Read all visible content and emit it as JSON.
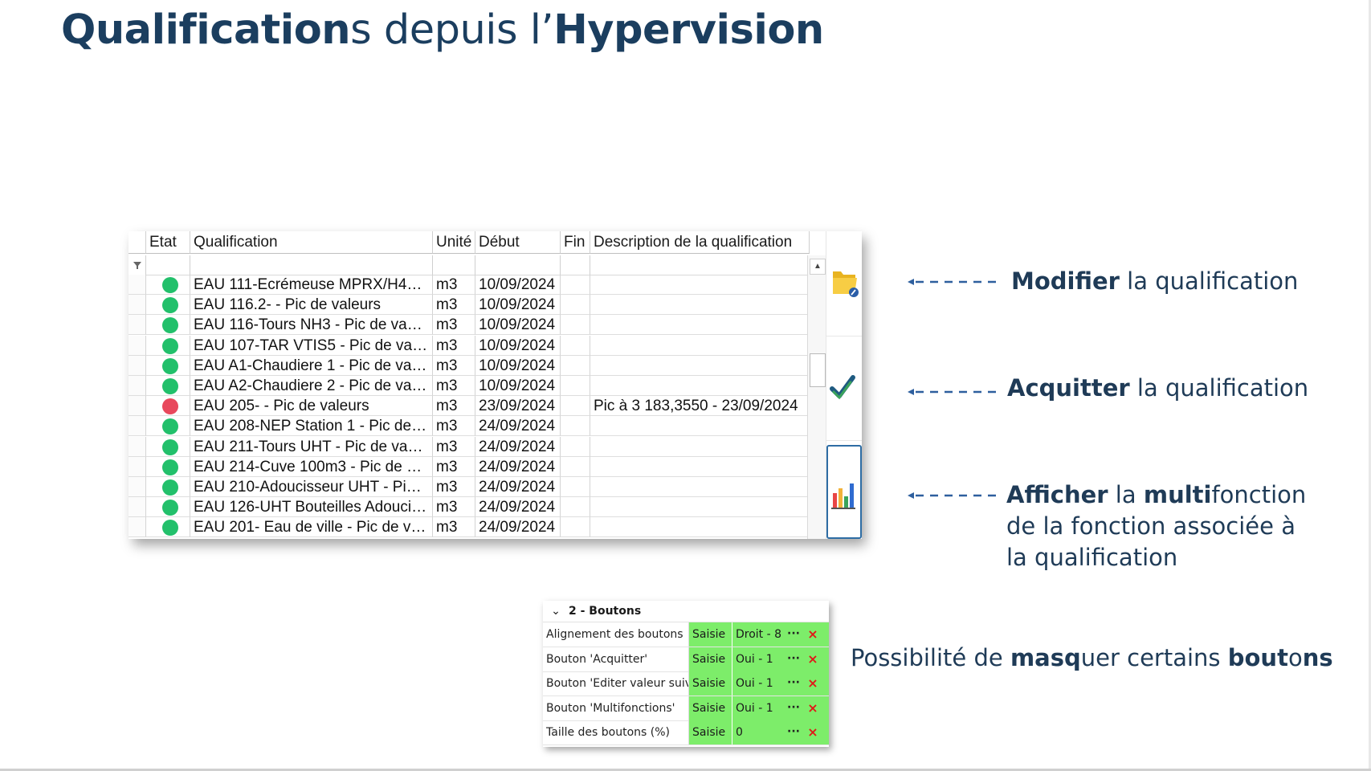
{
  "title": {
    "part1_bold": "Qualification",
    "part1_rest": "s depuis l’",
    "part2_bold": "Hypervision"
  },
  "grid": {
    "columns": {
      "etat": "Etat",
      "qualification": "Qualification",
      "unite": "Unité",
      "debut": "Début",
      "fin": "Fin",
      "description": "Description de la qualification"
    },
    "rows": [
      {
        "status": "ok",
        "qualification": "EAU 111-Ecrémeuse MPRX/H4…",
        "unite": "m3",
        "debut": "10/09/2024",
        "fin": "",
        "description": ""
      },
      {
        "status": "ok",
        "qualification": "EAU 116.2- - Pic de valeurs",
        "unite": "m3",
        "debut": "10/09/2024",
        "fin": "",
        "description": ""
      },
      {
        "status": "ok",
        "qualification": "EAU 116-Tours NH3 - Pic de va…",
        "unite": "m3",
        "debut": "10/09/2024",
        "fin": "",
        "description": ""
      },
      {
        "status": "ok",
        "qualification": "EAU 107-TAR VTIS5 - Pic de va…",
        "unite": "m3",
        "debut": "10/09/2024",
        "fin": "",
        "description": ""
      },
      {
        "status": "ok",
        "qualification": "EAU A1-Chaudiere 1 - Pic de va…",
        "unite": "m3",
        "debut": "10/09/2024",
        "fin": "",
        "description": ""
      },
      {
        "status": "ok",
        "qualification": "EAU A2-Chaudiere 2 - Pic de va…",
        "unite": "m3",
        "debut": "10/09/2024",
        "fin": "",
        "description": ""
      },
      {
        "status": "alert",
        "qualification": "EAU 205- - Pic de valeurs",
        "unite": "m3",
        "debut": "23/09/2024",
        "fin": "",
        "description": "Pic à 3 183,3550 - 23/09/2024"
      },
      {
        "status": "ok",
        "qualification": "EAU 208-NEP Station 1 - Pic de…",
        "unite": "m3",
        "debut": "24/09/2024",
        "fin": "",
        "description": ""
      },
      {
        "status": "ok",
        "qualification": "EAU 211-Tours UHT - Pic de va…",
        "unite": "m3",
        "debut": "24/09/2024",
        "fin": "",
        "description": ""
      },
      {
        "status": "ok",
        "qualification": "EAU 214-Cuve 100m3 - Pic de …",
        "unite": "m3",
        "debut": "24/09/2024",
        "fin": "",
        "description": ""
      },
      {
        "status": "ok",
        "qualification": "EAU 210-Adoucisseur UHT - Pi…",
        "unite": "m3",
        "debut": "24/09/2024",
        "fin": "",
        "description": ""
      },
      {
        "status": "ok",
        "qualification": "EAU 126-UHT Bouteilles Adouci…",
        "unite": "m3",
        "debut": "24/09/2024",
        "fin": "",
        "description": ""
      },
      {
        "status": "ok",
        "qualification": "EAU 201- Eau de ville - Pic de v…",
        "unite": "m3",
        "debut": "24/09/2024",
        "fin": "",
        "description": ""
      }
    ],
    "status_colors": {
      "ok": "#22c06b",
      "alert": "#e8485c"
    },
    "toolbar": [
      {
        "icon": "folder-edit-icon",
        "action": "modifier"
      },
      {
        "icon": "checkmark-icon",
        "action": "acquitter"
      },
      {
        "icon": "bar-chart-icon",
        "action": "multifonction"
      }
    ]
  },
  "annotations": {
    "modifier": {
      "bold": "Modifier",
      "rest": " la qualification"
    },
    "acquitter": {
      "bold": "Acquitter",
      "rest": " la qualification"
    },
    "afficher": {
      "bold1": "Afficher",
      "mid": " la ",
      "bold2": "multi",
      "rest": "fonction",
      "line2": "de la fonction associée à",
      "line3": "la  qualification"
    },
    "masquer": {
      "t1": "Possibilité de ",
      "b1": "masq",
      "t2": "uer certains ",
      "b2": "bout",
      "t3": "o",
      "b3": "ns"
    }
  },
  "settings_panel": {
    "section": "2 - Boutons",
    "rows": [
      {
        "label": "Alignement des boutons",
        "mode": "Saisie",
        "value": "Droit - 8"
      },
      {
        "label": "Bouton 'Acquitter'",
        "mode": "Saisie",
        "value": "Oui - 1"
      },
      {
        "label": "Bouton 'Editer valeur suivi'",
        "mode": "Saisie",
        "value": "Oui - 1"
      },
      {
        "label": "Bouton 'Multifonctions'",
        "mode": "Saisie",
        "value": "Oui - 1"
      },
      {
        "label": "Taille des boutons (%)",
        "mode": "Saisie",
        "value": "0"
      }
    ],
    "dots_label": "···",
    "delete_label": "×",
    "accent": "#7ded6a"
  }
}
